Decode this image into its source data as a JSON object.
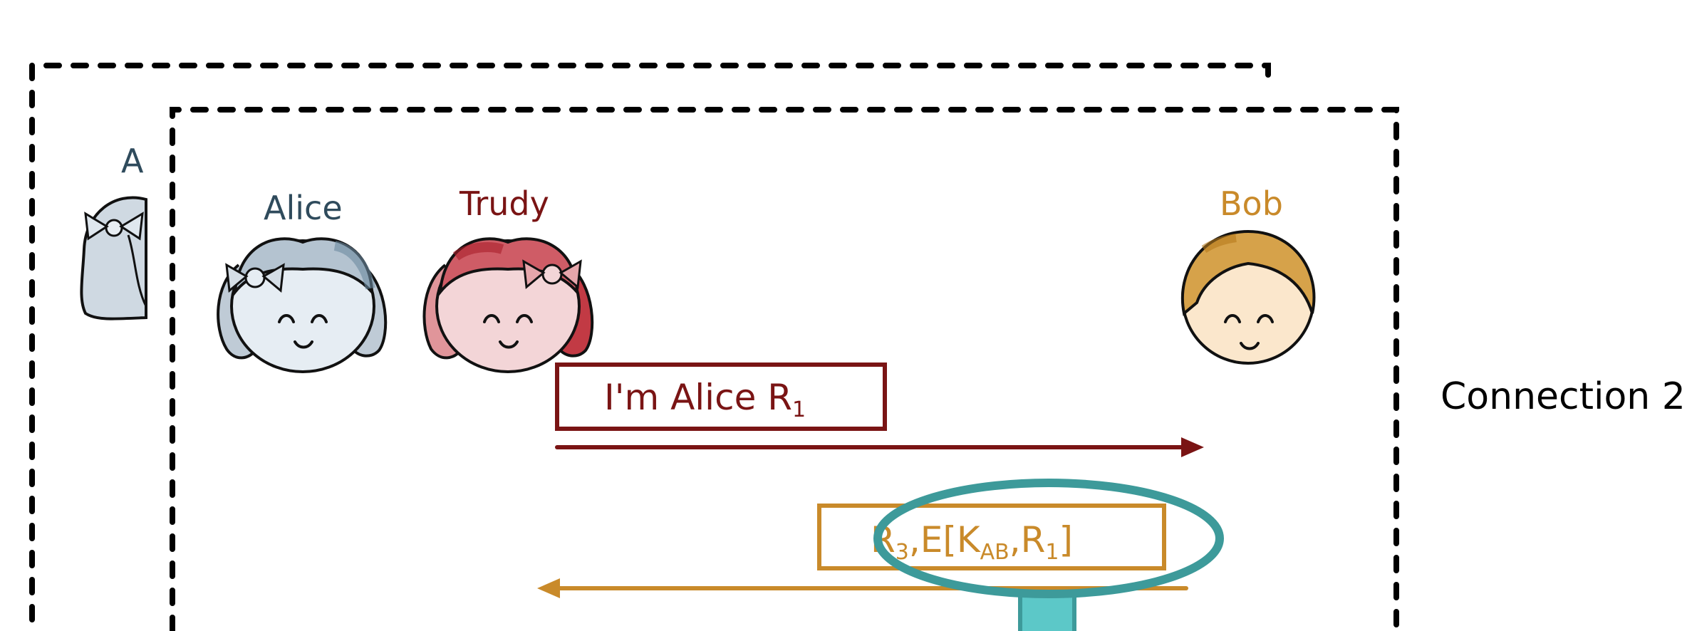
{
  "diagram": {
    "connection_label": "Connection 2",
    "back_frame": {
      "partial_name": "A"
    },
    "actors": {
      "alice": {
        "name": "Alice",
        "color": "#2f4b5c",
        "face_tint": "#9fb3c4"
      },
      "trudy": {
        "name": "Trudy",
        "color": "#7a1414",
        "face_tint": "#c9545a"
      },
      "bob": {
        "name": "Bob",
        "color": "#c98a2a",
        "face_tint": "#d6a24a"
      }
    },
    "messages": [
      {
        "id": "m1",
        "from": "trudy",
        "to": "bob",
        "text_main": "I'm Alice R",
        "text_sub": "1",
        "color": "#7a1414"
      },
      {
        "id": "m2",
        "from": "bob",
        "to": "trudy",
        "prefix": "R",
        "prefix_sub": "3",
        "text_main": ",E[K",
        "key_sub": "AB",
        "text_mid": ",R",
        "mid_sub": "1",
        "text_end": "]",
        "color": "#c98a2a"
      }
    ],
    "highlight": {
      "color": "#3d9a9a",
      "callout_fill": "#5cc8c8"
    }
  }
}
